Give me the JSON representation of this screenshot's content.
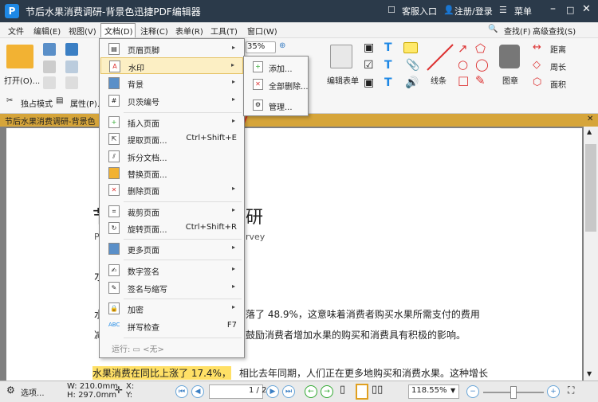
{
  "colors": {
    "titlebar": "#2b3a4a",
    "menu_highlight": "#fcefc4",
    "doc_tab": "#d6a53a",
    "highlight_text": "#ffe066",
    "arrow": "#e0352b",
    "accent": "#1e88e5"
  },
  "titlebar": {
    "logo": "P",
    "title": "节后水果消费调研-背景色迅捷PDF编辑器",
    "service": "客服入口",
    "login": "注册/登录",
    "menu": "菜单"
  },
  "menubar": [
    "文件",
    "编辑(E)",
    "视图(V)",
    "文档(D)",
    "注释(C)",
    "表单(R)",
    "工具(T)",
    "窗口(W)"
  ],
  "ribbon": {
    "open": "打开(O)...",
    "exclusive_mode": "独占模式",
    "properties": "属性(P)...",
    "zoom_value": "35%",
    "edit_form": "编辑表单",
    "line": "线条",
    "stamp": "图章",
    "find": "查找(F)",
    "advanced_find": "高级查找(S)",
    "distance": "距离",
    "perimeter": "周长",
    "area": "面积"
  },
  "doc_tab": "节后水果消费调研-背景色",
  "page": {
    "title_fragment_left": "节",
    "title_fragment_right": "研",
    "subtitle_left": "P",
    "subtitle_right": "rvey",
    "marker": "水",
    "line1_left": "水",
    "line1": "落了 48.9%，这意味着消费者购买水果所需支付的费用",
    "line2_left": "减",
    "line2": "鼓励消费者增加水果的购买和消费具有积极的影响。",
    "highlight": "水果消费在同比上涨了 17.4%，",
    "line3": "相比去年同期，人们正在更多地购买和消费水果。这种增长"
  },
  "dropdown": [
    {
      "label": "页眉页脚",
      "arrow": "▸"
    },
    {
      "label": "水印",
      "arrow": "▸",
      "active": true
    },
    {
      "label": "背景",
      "arrow": "▸"
    },
    {
      "label": "贝茨编号",
      "arrow": "▸"
    },
    {
      "label": "插入页面",
      "arrow": "▸"
    },
    {
      "label": "提取页面...",
      "shortcut": "Ctrl+Shift+E"
    },
    {
      "label": "拆分文档..."
    },
    {
      "label": "替换页面..."
    },
    {
      "label": "删除页面",
      "arrow": "▸"
    },
    {
      "label": "裁剪页面",
      "arrow": "▸"
    },
    {
      "label": "旋转页面...",
      "shortcut": "Ctrl+Shift+R"
    },
    {
      "label": "更多页面",
      "arrow": "▸"
    },
    {
      "label": "数字签名",
      "arrow": "▸"
    },
    {
      "label": "签名与缩写",
      "arrow": "▸"
    },
    {
      "label": "加密",
      "arrow": "▸"
    },
    {
      "label": "拼写检查",
      "shortcut": "F7"
    },
    {
      "label": "运行: ▭ <无>"
    }
  ],
  "submenu": [
    "添加...",
    "全部删除...",
    "管理..."
  ],
  "statusbar": {
    "options": "选项...",
    "width": "W: 210.0mm",
    "height": "H: 297.0mm",
    "x": "X:",
    "y": "Y:",
    "page": "1 / 2",
    "zoom": "118.55%"
  }
}
